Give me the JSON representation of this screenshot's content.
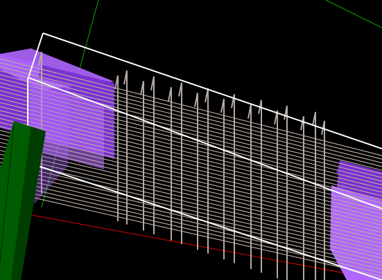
{
  "viewport": {
    "background_color": "#000000",
    "caption": ""
  },
  "scene": {
    "axis_x_color": "#e00000",
    "axis_y_color": "#00b000",
    "box_edge_color": "#ffffff",
    "wire_color": "#b7aaa3",
    "support_color_light": "#b066ff",
    "support_color_dark": "#7a2fd0",
    "clamp_color": "#005c00"
  }
}
